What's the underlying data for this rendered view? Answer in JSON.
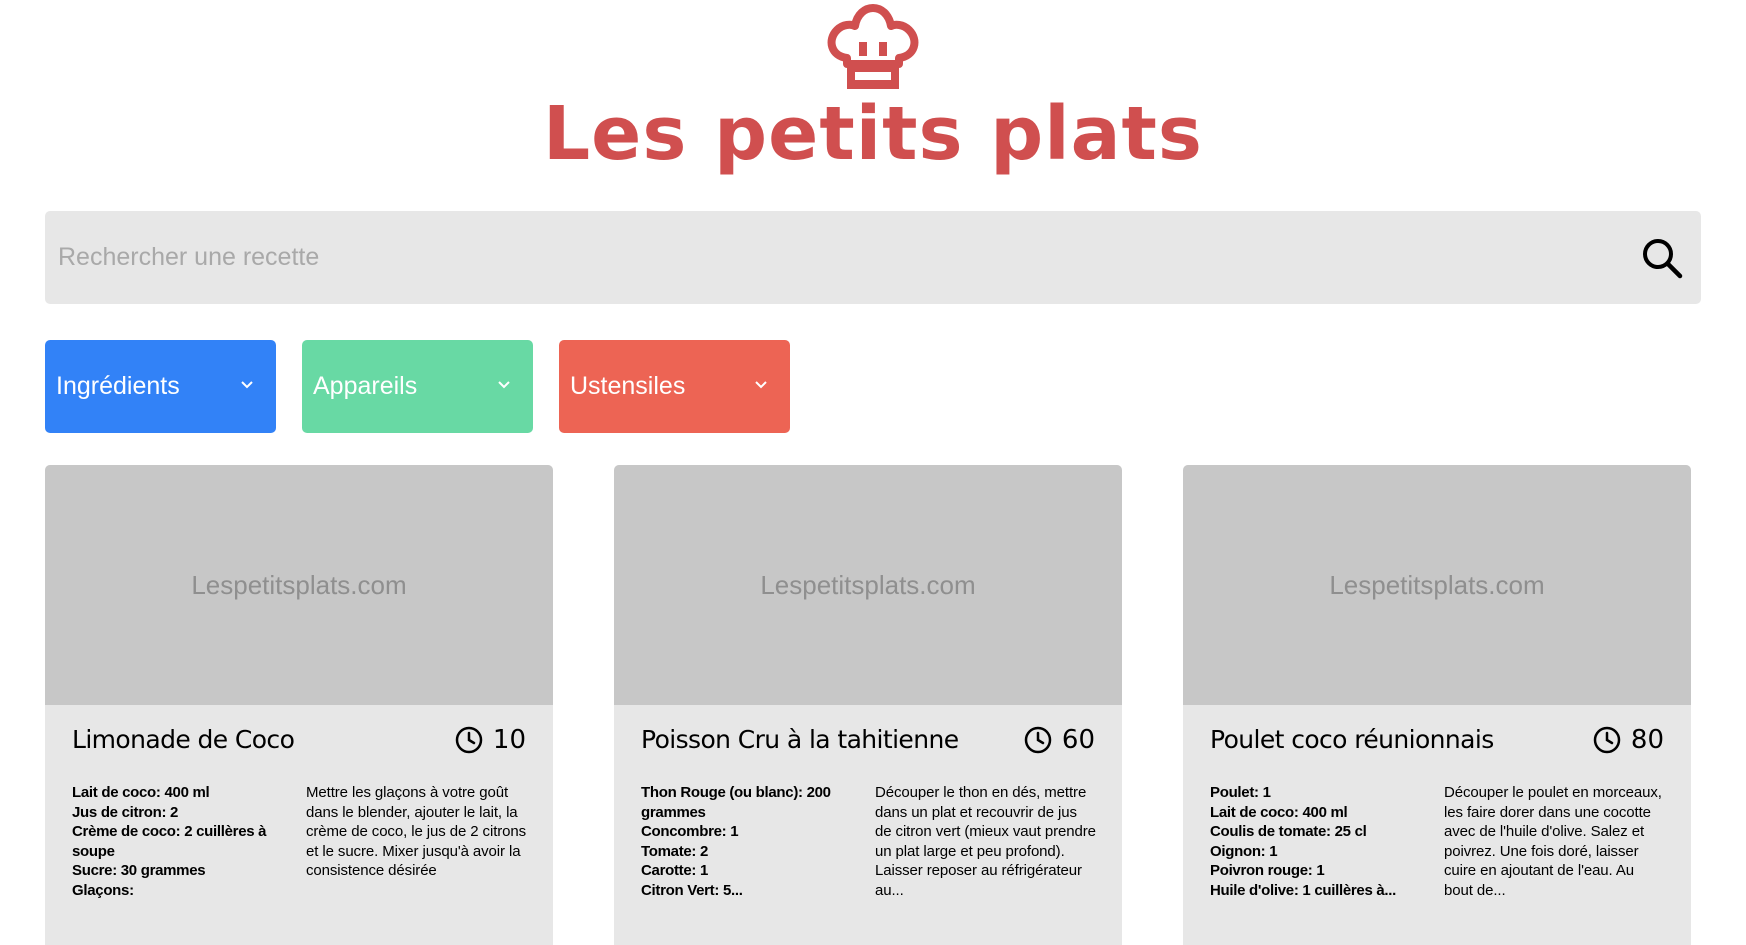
{
  "header": {
    "logo_icon": "chef-hat-icon",
    "title": "Les petits plats",
    "brand_color": "#D04F4F"
  },
  "search": {
    "placeholder": "Rechercher une recette",
    "value": "",
    "icon": "search-icon"
  },
  "filters": [
    {
      "label": "Ingrédients",
      "color": "#3282F7",
      "icon": "chevron-down-icon"
    },
    {
      "label": "Appareils",
      "color": "#68D9A4",
      "icon": "chevron-down-icon"
    },
    {
      "label": "Ustensiles",
      "color": "#ED6454",
      "icon": "chevron-down-icon"
    }
  ],
  "recipes": [
    {
      "image_text": "Lespetitsplats.com",
      "title": "Limonade de Coco",
      "time": "10",
      "time_icon": "clock-icon",
      "ingredients": [
        "Lait de coco: 400 ml",
        "Jus de citron: 2",
        "Crème de coco: 2 cuillères à soupe",
        "Sucre: 30 grammes",
        "Glaçons:"
      ],
      "description": "Mettre les glaçons à votre goût dans le blender, ajouter le lait, la crème de coco, le jus de 2 citrons et le sucre. Mixer jusqu'à avoir la consistence désirée"
    },
    {
      "image_text": "Lespetitsplats.com",
      "title": "Poisson Cru à la tahitienne",
      "time": "60",
      "time_icon": "clock-icon",
      "ingredients": [
        "Thon Rouge (ou blanc): 200 grammes",
        "Concombre: 1",
        "Tomate: 2",
        "Carotte: 1",
        "Citron Vert: 5..."
      ],
      "description": "Découper le thon en dés, mettre dans un plat et recouvrir de jus de citron vert (mieux vaut prendre un plat large et peu profond). Laisser reposer au réfrigérateur au..."
    },
    {
      "image_text": "Lespetitsplats.com",
      "title": "Poulet coco réunionnais",
      "time": "80",
      "time_icon": "clock-icon",
      "ingredients": [
        "Poulet: 1",
        "Lait de coco: 400 ml",
        "Coulis de tomate: 25 cl",
        "Oignon: 1",
        "Poivron rouge: 1",
        "Huile d'olive: 1 cuillères à..."
      ],
      "description": "Découper le poulet en morceaux, les faire dorer dans une cocotte avec de l'huile d'olive. Salez et poivrez. Une fois doré, laisser cuire en ajoutant de l'eau. Au bout de..."
    }
  ]
}
